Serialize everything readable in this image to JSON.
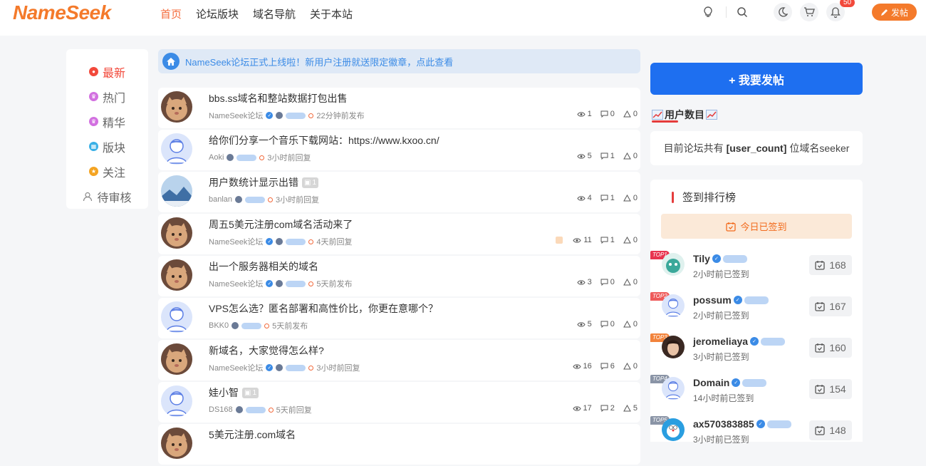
{
  "header": {
    "logo": "NameSeek",
    "nav": [
      {
        "label": "首页",
        "active": true
      },
      {
        "label": "论坛版块",
        "active": false
      },
      {
        "label": "域名导航",
        "active": false
      },
      {
        "label": "关于本站",
        "active": false
      }
    ],
    "notification_count": "50",
    "post_button": "发帖"
  },
  "left_menu": [
    {
      "label": "最新",
      "icon": "fire-icon",
      "color": "#f2493b",
      "active": true
    },
    {
      "label": "热门",
      "icon": "crown-icon",
      "color": "#d270e0",
      "active": false
    },
    {
      "label": "精华",
      "icon": "crown-icon",
      "color": "#d270e0",
      "active": false
    },
    {
      "label": "版块",
      "icon": "grid-icon",
      "color": "#3ab0e6",
      "active": false
    },
    {
      "label": "关注",
      "icon": "star-icon",
      "color": "#f4a422",
      "active": false
    },
    {
      "label": "待审核",
      "icon": "user-icon",
      "color": "#888888",
      "active": false
    }
  ],
  "notice": "NameSeek论坛正式上线啦！新用户注册就送限定徽章，点此查看",
  "posts": [
    {
      "title": "bbs.ss域名和整站数据打包出售",
      "author": "NameSeek论坛",
      "verified": true,
      "time": "22分钟前发布",
      "views": "1",
      "comments": "0",
      "likes": "0",
      "avatar": "cat",
      "img_count": "",
      "locked": false
    },
    {
      "title": "给你们分享一个音乐下载网站：https://www.kxoo.cn/",
      "author": "Aoki",
      "verified": false,
      "time": "3小时前回复",
      "views": "5",
      "comments": "1",
      "likes": "0",
      "avatar": "default",
      "img_count": "",
      "locked": false
    },
    {
      "title": "用户数统计显示出错",
      "author": "banlan",
      "verified": false,
      "time": "3小时前回复",
      "views": "4",
      "comments": "1",
      "likes": "0",
      "avatar": "landscape",
      "img_count": "1",
      "locked": false
    },
    {
      "title": "周五5美元注册com域名活动来了",
      "author": "NameSeek论坛",
      "verified": true,
      "time": "4天前回复",
      "views": "11",
      "comments": "1",
      "likes": "0",
      "avatar": "cat",
      "img_count": "",
      "locked": true
    },
    {
      "title": "出一个服务器相关的域名",
      "author": "NameSeek论坛",
      "verified": true,
      "time": "5天前发布",
      "views": "3",
      "comments": "0",
      "likes": "0",
      "avatar": "cat",
      "img_count": "",
      "locked": false
    },
    {
      "title": "VPS怎么选？匿名部署和高性价比，你更在意哪个？",
      "author": "BKK0",
      "verified": false,
      "time": "5天前发布",
      "views": "5",
      "comments": "0",
      "likes": "0",
      "avatar": "default",
      "img_count": "",
      "locked": false
    },
    {
      "title": "新域名，大家觉得怎么样?",
      "author": "NameSeek论坛",
      "verified": true,
      "time": "3小时前回复",
      "views": "16",
      "comments": "6",
      "likes": "0",
      "avatar": "cat",
      "img_count": "",
      "locked": false
    },
    {
      "title": "娃小智",
      "author": "DS168",
      "verified": false,
      "time": "5天前回复",
      "views": "17",
      "comments": "2",
      "likes": "5",
      "avatar": "default",
      "img_count": "1",
      "locked": false
    },
    {
      "title": "5美元注册.com域名",
      "author": "",
      "verified": false,
      "time": "",
      "views": "",
      "comments": "",
      "likes": "",
      "avatar": "cat",
      "img_count": "",
      "locked": false
    }
  ],
  "sidebar": {
    "big_post_button": "+ 我要发帖",
    "user_count_title": "用户数目",
    "user_count_prefix": "目前论坛共有",
    "user_count_value": "[user_count]",
    "user_count_suffix": "位域名seeker",
    "rank_title": "签到排行榜",
    "signed_label": "今日已签到",
    "rank": [
      {
        "tag": "TOP1",
        "tag_color": "#e8344f",
        "name": "Tily",
        "time": "2小时前已签到",
        "count": "168",
        "avatar": "teal"
      },
      {
        "tag": "TOP2",
        "tag_color": "#ee5a5a",
        "name": "possum",
        "time": "2小时前已签到",
        "count": "167",
        "avatar": "default"
      },
      {
        "tag": "TOP3",
        "tag_color": "#f2833b",
        "name": "jeromeliaya",
        "time": "3小时前已签到",
        "count": "160",
        "avatar": "portrait"
      },
      {
        "tag": "TOP4",
        "tag_color": "#8a94a6",
        "name": "Domain",
        "time": "14小时前已签到",
        "count": "154",
        "avatar": "default"
      },
      {
        "tag": "TOP5",
        "tag_color": "#8a94a6",
        "name": "ax570383885",
        "time": "3小时前已签到",
        "count": "148",
        "avatar": "doraemon"
      }
    ]
  }
}
